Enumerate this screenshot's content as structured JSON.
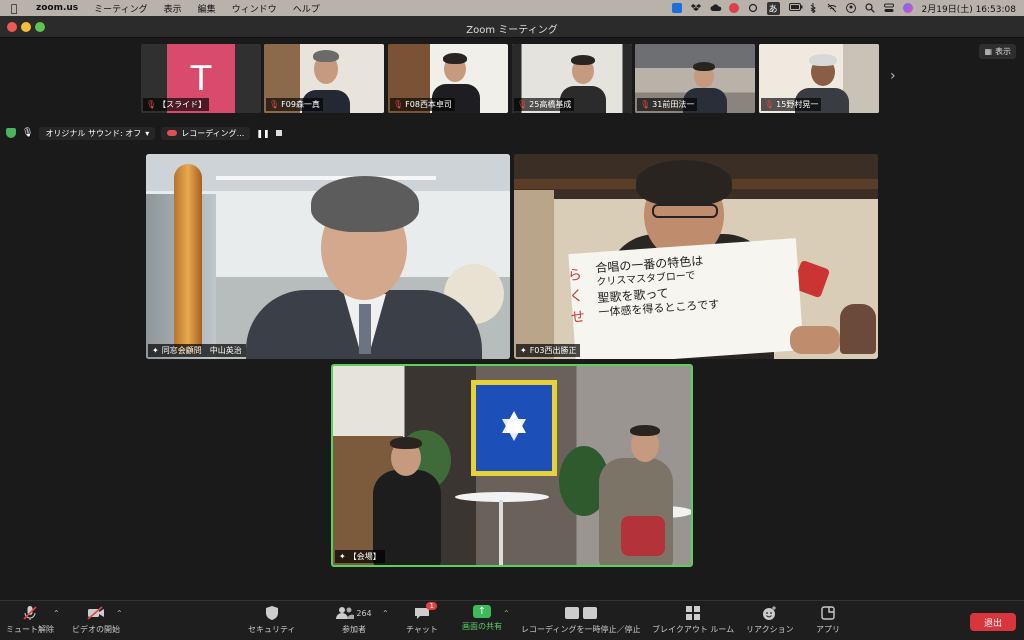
{
  "menubar": {
    "apple": "",
    "app_name": "zoom.us",
    "items": [
      "ミーティング",
      "表示",
      "編集",
      "ウィンドウ",
      "ヘルプ"
    ],
    "ime": "あ",
    "clock": "2月19日(土)  16:53:08"
  },
  "window": {
    "title": "Zoom ミーティング"
  },
  "thumbnails": [
    {
      "name": "【スライド】"
    },
    {
      "name": "F09森一真"
    },
    {
      "name": "F08西本卓司"
    },
    {
      "name": "25高橋基成"
    },
    {
      "name": "31前田法一"
    },
    {
      "name": "15野村晃一"
    }
  ],
  "avatar_letter": "T",
  "view_button": "表示",
  "status_row": {
    "original_sound": "オリジナル サウンド: オフ",
    "recording": "レコーディング..."
  },
  "tiles": {
    "a": {
      "name": "同窓会顧問　中山英治"
    },
    "b": {
      "name": "F03西出勝正",
      "note_side": [
        "ら",
        "く",
        "せ"
      ],
      "note_lines": [
        "合唱の一番の特色は",
        "クリスマスタブローで",
        "聖歌を歌って",
        "一体感を得るところです"
      ]
    },
    "c": {
      "name": "【会場】"
    }
  },
  "toolbar": {
    "unmute": "ミュート解除",
    "video": "ビデオの開始",
    "security": "セキュリティ",
    "participants": "参加者",
    "participant_count": "264",
    "chat": "チャット",
    "chat_badge": "1",
    "share": "画面の共有",
    "pause_recording": "レコーディングを一時停止／停止",
    "breakout": "ブレイクアウト ルーム",
    "reactions": "リアクション",
    "apps": "アプリ",
    "leave": "退出"
  },
  "colors": {
    "share_green": "#3dbb5a",
    "leave_red": "#d8353d",
    "active_speaker": "#5bd05b"
  }
}
